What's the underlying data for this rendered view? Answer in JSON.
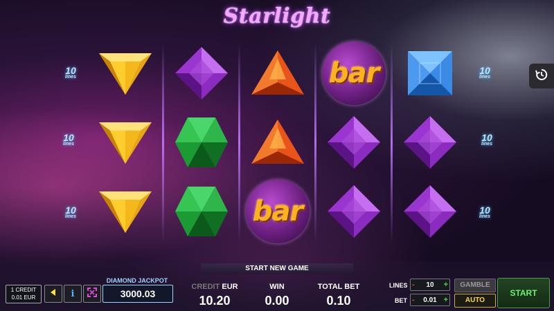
{
  "game": {
    "title": "Starlight"
  },
  "reels": [
    [
      "yellow-gem",
      "yellow-gem",
      "yellow-gem"
    ],
    [
      "purple-gem",
      "green-gem",
      "green-gem"
    ],
    [
      "orange-gem",
      "orange-gem",
      "bar"
    ],
    [
      "bar",
      "purple-gem",
      "purple-gem"
    ],
    [
      "blue-gem",
      "purple-gem",
      "purple-gem"
    ]
  ],
  "bar_label": "bar",
  "line_badges": {
    "number": "10",
    "text": "lines"
  },
  "start_new_game": "START NEW GAME",
  "credit_box": {
    "line1": "1 CREDIT",
    "line2": "0.01 EUR"
  },
  "jackpot": {
    "label": "DIAMOND JACKPOT",
    "value": "3000.03"
  },
  "credit": {
    "label": "CREDIT",
    "currency": "EUR",
    "value": "10.20"
  },
  "win": {
    "label": "WIN",
    "value": "0.00"
  },
  "total_bet": {
    "label": "TOTAL BET",
    "value": "0.10"
  },
  "lines": {
    "label": "LINES",
    "value": "10"
  },
  "bet": {
    "label": "BET",
    "value": "0.01"
  },
  "stepper_symbols": {
    "minus": "-",
    "plus": "+"
  },
  "buttons": {
    "gamble": "GAMBLE",
    "auto": "AUTO",
    "start": "START"
  },
  "colors": {
    "accent_green": "#6ef06e",
    "auto_yellow": "#ffd84a",
    "jackpot_blue": "#9fd4ff"
  }
}
